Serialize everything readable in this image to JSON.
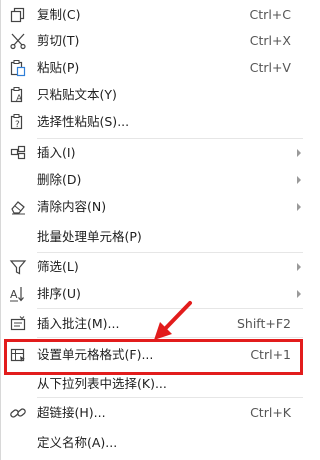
{
  "menu": {
    "items": [
      {
        "label": "复制(C)",
        "shortcut": "Ctrl+C",
        "icon": "copy-icon"
      },
      {
        "label": "剪切(T)",
        "shortcut": "Ctrl+X",
        "icon": "scissors-icon"
      },
      {
        "label": "粘贴(P)",
        "shortcut": "Ctrl+V",
        "icon": "paste-icon"
      },
      {
        "label": "只粘贴文本(Y)",
        "shortcut": "",
        "icon": "paste-text-icon"
      },
      {
        "label": "选择性粘贴(S)...",
        "shortcut": "",
        "icon": "paste-special-icon"
      },
      {
        "label": "插入(I)",
        "shortcut": "",
        "icon": "insert-icon"
      },
      {
        "label": "删除(D)",
        "shortcut": "",
        "icon": ""
      },
      {
        "label": "清除内容(N)",
        "shortcut": "",
        "icon": "eraser-icon"
      },
      {
        "label": "批量处理单元格(P)",
        "shortcut": "",
        "icon": ""
      },
      {
        "label": "筛选(L)",
        "shortcut": "",
        "icon": "filter-icon"
      },
      {
        "label": "排序(U)",
        "shortcut": "",
        "icon": "sort-icon"
      },
      {
        "label": "插入批注(M)...",
        "shortcut": "Shift+F2",
        "icon": "comment-icon"
      },
      {
        "label": "设置单元格格式(F)...",
        "shortcut": "Ctrl+1",
        "icon": "format-cells-icon"
      },
      {
        "label": "从下拉列表中选择(K)...",
        "shortcut": "",
        "icon": ""
      },
      {
        "label": "超链接(H)...",
        "shortcut": "Ctrl+K",
        "icon": "link-icon"
      },
      {
        "label": "定义名称(A)...",
        "shortcut": "",
        "icon": ""
      }
    ]
  },
  "colors": {
    "highlight": "#e21c1c",
    "text": "#1e1e1e",
    "shortcut": "#555555"
  }
}
